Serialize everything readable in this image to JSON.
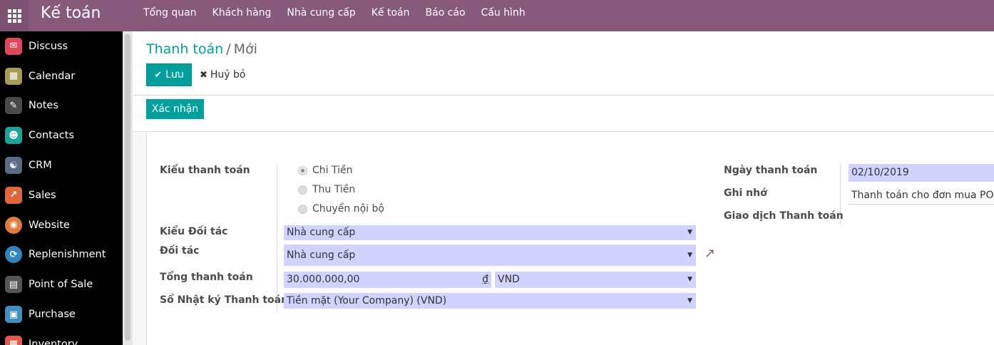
{
  "app": {
    "title": "Kế toán",
    "menu": [
      "Tổng quan",
      "Khách hàng",
      "Nhà cung cấp",
      "Kế toán",
      "Báo cáo",
      "Cấu hình"
    ]
  },
  "sidebar": {
    "items": [
      {
        "label": "Discuss",
        "icon": "discuss-icon",
        "color": "#e0475b"
      },
      {
        "label": "Calendar",
        "icon": "calendar-icon",
        "color": "#a89c55"
      },
      {
        "label": "Notes",
        "icon": "notes-icon",
        "color": "#4a4a4a"
      },
      {
        "label": "Contacts",
        "icon": "contacts-icon",
        "color": "#1ea39a"
      },
      {
        "label": "CRM",
        "icon": "crm-icon",
        "color": "#5b6c84"
      },
      {
        "label": "Sales",
        "icon": "sales-icon",
        "color": "#e0663d"
      },
      {
        "label": "Website",
        "icon": "website-icon",
        "color": "#e07a3d"
      },
      {
        "label": "Replenishment",
        "icon": "replenishment-icon",
        "color": "#2e86c1"
      },
      {
        "label": "Point of Sale",
        "icon": "point-of-sale-icon",
        "color": "#555555"
      },
      {
        "label": "Purchase",
        "icon": "purchase-icon",
        "color": "#3f8fbf"
      },
      {
        "label": "Inventory",
        "icon": "inventory-icon",
        "color": "#e05b4a"
      }
    ]
  },
  "breadcrumb": {
    "parent": "Thanh toán",
    "current": "Mới"
  },
  "buttons": {
    "save": "Lưu",
    "cancel": "Huỷ bỏ",
    "confirm": "Xác nhận"
  },
  "form": {
    "payment_type_label": "Kiểu thanh toán",
    "payment_type_options": [
      "Chi Tiền",
      "Thu Tiền",
      "Chuyển nội bộ"
    ],
    "payment_type_selected": "Chi Tiền",
    "partner_type_label": "Kiểu Đối tác",
    "partner_type_value": "Nhà cung cấp",
    "partner_label": "Đối tác",
    "partner_value": "Nhà cung cấp",
    "amount_label": "Tổng thanh toán",
    "amount_value": "30.000.000,00",
    "amount_currency_symbol": "₫",
    "currency_value": "VND",
    "journal_label": "Sổ Nhật ký Thanh toán",
    "journal_value": "Tiền mặt (Your Company) (VND)",
    "date_label": "Ngày thanh toán",
    "date_value": "02/10/2019",
    "memo_label": "Ghi nhớ",
    "memo_value": "Thanh toán cho đơn mua PO.....",
    "transaction_label": "Giao dịch Thanh toán"
  },
  "colors": {
    "brand": "#875a7b",
    "accent": "#00a09d",
    "field_bg": "#d2d2ff"
  }
}
